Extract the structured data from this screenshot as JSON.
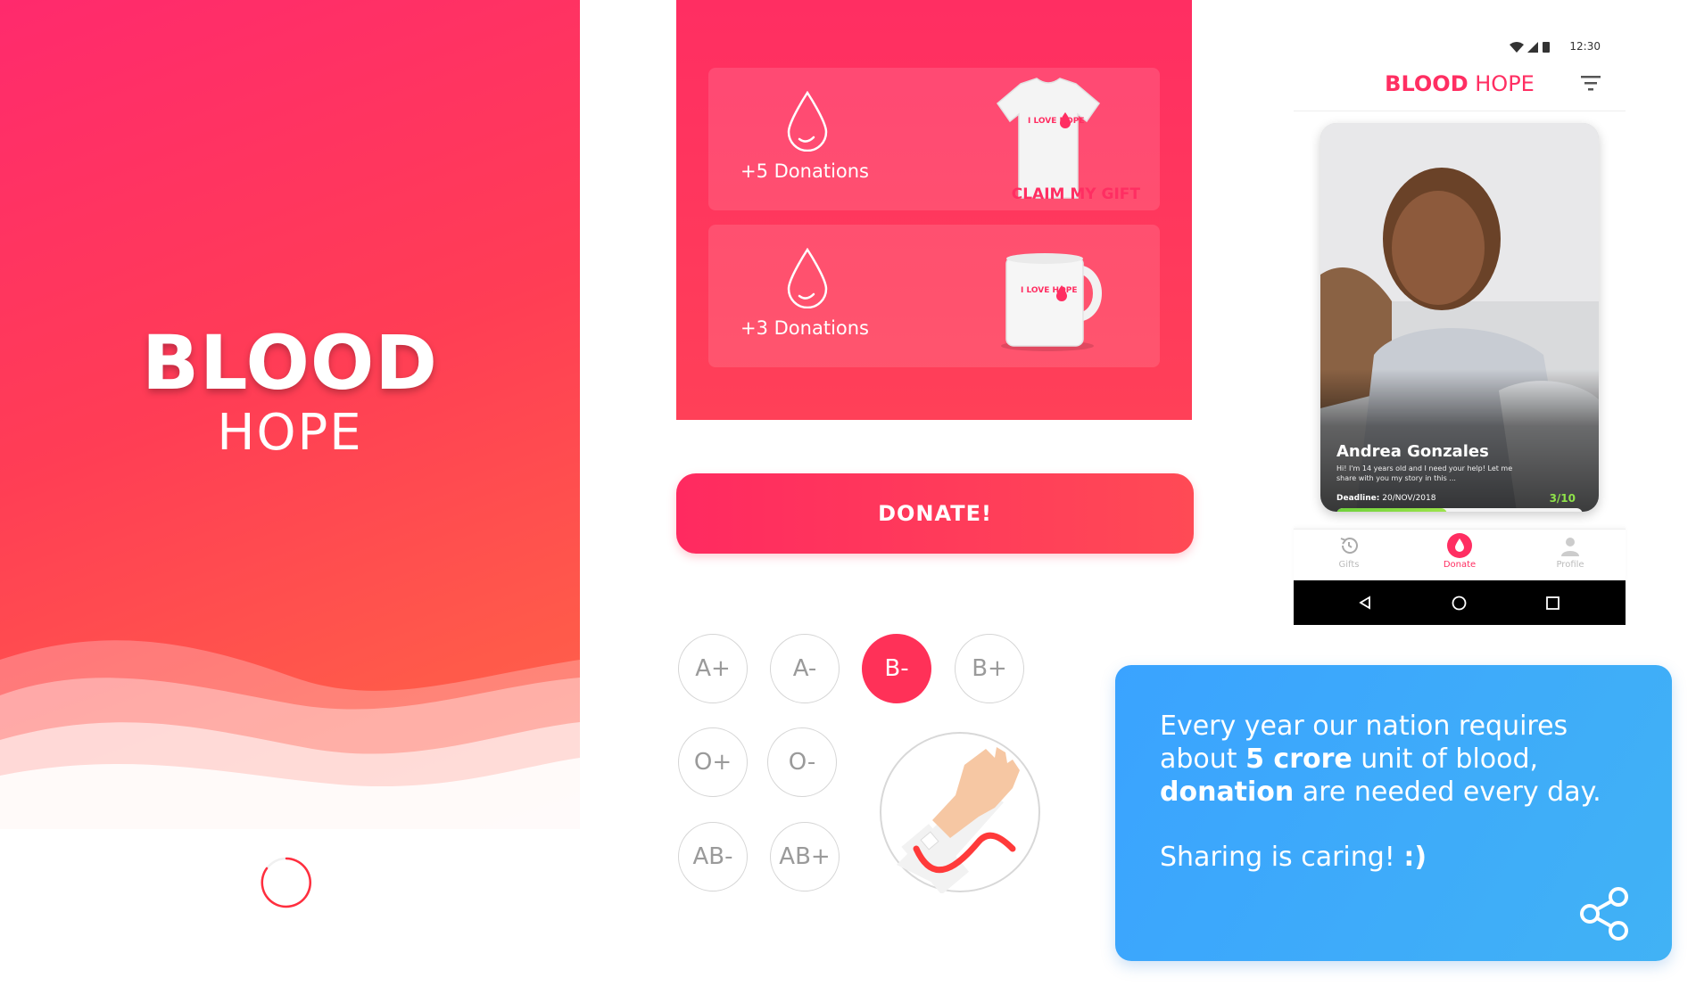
{
  "splash": {
    "title": "BLOOD",
    "subtitle": "HOPE"
  },
  "gifts": {
    "items": [
      {
        "count": "+5 Donations",
        "claim": "CLAIM MY GIFT",
        "product": "t-shirt",
        "print": "I LOVE HOPE"
      },
      {
        "count": "+3 Donations",
        "claim": "",
        "product": "mug",
        "print": "I LOVE HOPE"
      }
    ]
  },
  "donate_button": "DONATE!",
  "blood_types": {
    "options": [
      "A+",
      "A-",
      "B-",
      "B+",
      "O+",
      "O-",
      "AB-",
      "AB+"
    ],
    "selected": "B-"
  },
  "phone": {
    "status_time": "12:30",
    "app_title_bold": "BLOOD",
    "app_title_light": " HOPE",
    "story": {
      "name": "Andrea Gonzales",
      "text": "Hi! I'm 14 years old and I need your help! Let me share with you my story in this ...",
      "deadline_label": "Deadline:",
      "deadline_value": " 20/NOV/2018",
      "progress_label": "3/10",
      "progress_fraction": 0.45
    },
    "nav": [
      {
        "label": "Gifts",
        "icon": "history-icon",
        "active": false
      },
      {
        "label": "Donate",
        "icon": "blood-drop-icon",
        "active": true
      },
      {
        "label": "Profile",
        "icon": "person-icon",
        "active": false
      }
    ]
  },
  "share_card": {
    "line1": "Every year our nation requires",
    "line2_a": "about ",
    "line2_b": "5 crore",
    "line2_c": " unit of blood,",
    "line3_a": "donation",
    "line3_b": " are needed every day.",
    "tag_a": "Sharing is caring! ",
    "tag_b": ":)"
  },
  "colors": {
    "brand_red": "#ff2e62",
    "share_blue": "#3aa3ff",
    "progress_green": "#8fe34a"
  }
}
